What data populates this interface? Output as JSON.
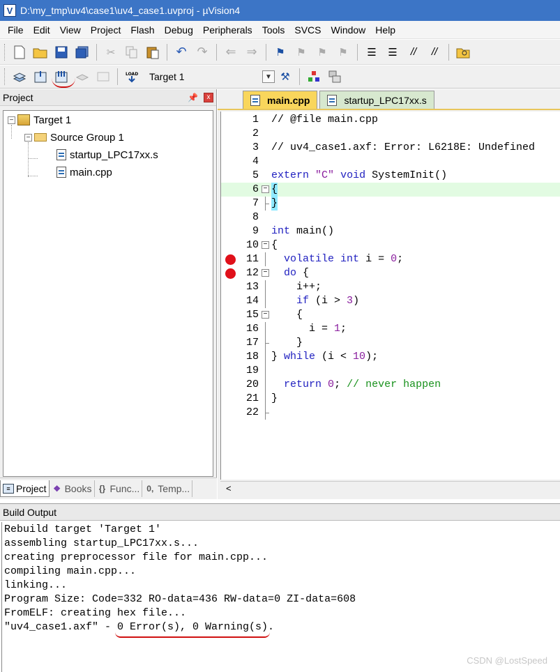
{
  "titlebar": {
    "title": "D:\\my_tmp\\uv4\\case1\\uv4_case1.uvproj - µVision4"
  },
  "menu": [
    "File",
    "Edit",
    "View",
    "Project",
    "Flash",
    "Debug",
    "Peripherals",
    "Tools",
    "SVCS",
    "Window",
    "Help"
  ],
  "toolbar2": {
    "target": "Target 1"
  },
  "project_panel": {
    "title": "Project",
    "pin": "ꟸ",
    "close": "x",
    "tree": {
      "target": "Target 1",
      "group": "Source Group 1",
      "files": [
        "startup_LPC17xx.s",
        "main.cpp"
      ]
    },
    "tabs": [
      {
        "label": "Project"
      },
      {
        "label": "Books"
      },
      {
        "label": "Func..."
      },
      {
        "label": "Temp..."
      }
    ]
  },
  "editor": {
    "tabs": [
      {
        "label": "main.cpp"
      },
      {
        "label": "startup_LPC17xx.s"
      }
    ],
    "lines": [
      {
        "n": "1",
        "text": "// @file main.cpp"
      },
      {
        "n": "2",
        "text": ""
      },
      {
        "n": "3",
        "text": "// uv4_case1.axf: Error: L6218E: Undefined"
      },
      {
        "n": "4",
        "text": ""
      },
      {
        "n": "5",
        "text": "extern \"C\" void SystemInit()"
      },
      {
        "n": "6",
        "text": "{"
      },
      {
        "n": "7",
        "text": "}"
      },
      {
        "n": "8",
        "text": ""
      },
      {
        "n": "9",
        "text": "int main()"
      },
      {
        "n": "10",
        "text": "{"
      },
      {
        "n": "11",
        "text": "  volatile int i = 0;"
      },
      {
        "n": "12",
        "text": "  do {"
      },
      {
        "n": "13",
        "text": "    i++;"
      },
      {
        "n": "14",
        "text": "    if (i > 3)"
      },
      {
        "n": "15",
        "text": "    {"
      },
      {
        "n": "16",
        "text": "      i = 1;"
      },
      {
        "n": "17",
        "text": "    }"
      },
      {
        "n": "18",
        "text": "} while (i < 10);"
      },
      {
        "n": "19",
        "text": ""
      },
      {
        "n": "20",
        "text": "  return 0; // never happen"
      },
      {
        "n": "21",
        "text": "}"
      },
      {
        "n": "22",
        "text": ""
      }
    ],
    "hscroll_arrow": "<"
  },
  "build_output": {
    "title": "Build Output",
    "lines": [
      "Rebuild target 'Target 1'",
      "assembling startup_LPC17xx.s...",
      "creating preprocessor file for main.cpp...",
      "compiling main.cpp...",
      "linking...",
      "Program Size: Code=332 RO-data=436 RW-data=0 ZI-data=608",
      "FromELF: creating hex file...",
      "\"uv4_case1.axf\" - 0 Error(s), 0 Warning(s)."
    ]
  },
  "watermark": "CSDN @LostSpeed"
}
